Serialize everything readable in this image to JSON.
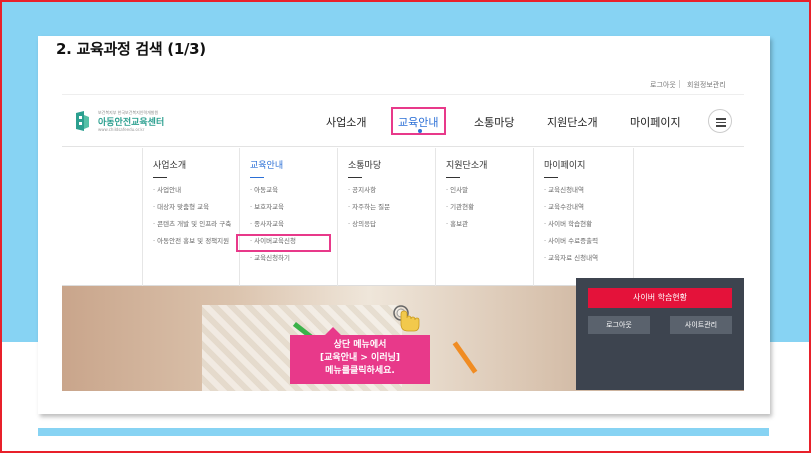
{
  "slide": {
    "title": "2. 교육과정 검색 (1/3)"
  },
  "utility": {
    "logout": "로그아웃",
    "member_info": "회원정보관리"
  },
  "logo": {
    "small_text": "보건복지부 한국보건복지인력개발원",
    "name": "아동안전교육센터",
    "url": "www.childsafeedu.or.kr"
  },
  "nav": {
    "items": [
      "사업소개",
      "교육안내",
      "소통마당",
      "지원단소개",
      "마이페이지"
    ],
    "active_index": 1
  },
  "dropdown": {
    "columns": [
      {
        "title": "사업소개",
        "items": [
          "사업안내",
          "대상자 맞춤형 교육",
          "콘텐츠 개발 및 인프라 구축",
          "아동안전 홍보 및 정책지원"
        ]
      },
      {
        "title": "교육안내",
        "items": [
          "아동교육",
          "보호자교육",
          "종사자교육",
          "사이버교육신청",
          "교육신청하기"
        ]
      },
      {
        "title": "소통마당",
        "items": [
          "공지사항",
          "자주하는 질문",
          "상의응답"
        ]
      },
      {
        "title": "지원단소개",
        "items": [
          "인사말",
          "기관현황",
          "홍보관"
        ]
      },
      {
        "title": "마이페이지",
        "items": [
          "교육신청내역",
          "교육수강내역",
          "사이버 학습현황",
          "사이버 수료증출력",
          "교육자료 신청내역"
        ]
      }
    ]
  },
  "panel": {
    "cyber_status": "사이버 학습현황",
    "logout": "로그아웃",
    "site_admin": "사이트관리"
  },
  "callout": {
    "line1": "상단 메뉴에서",
    "line2": "[교육안내 > 이러닝]",
    "line3": "메뉴를클릭하세요."
  },
  "colors": {
    "highlight": "#e8398a",
    "accent_blue": "#2b6fd6",
    "sky_band": "#87d3f3",
    "brand_green": "#2b9f8f",
    "red_button": "#e4123a"
  }
}
